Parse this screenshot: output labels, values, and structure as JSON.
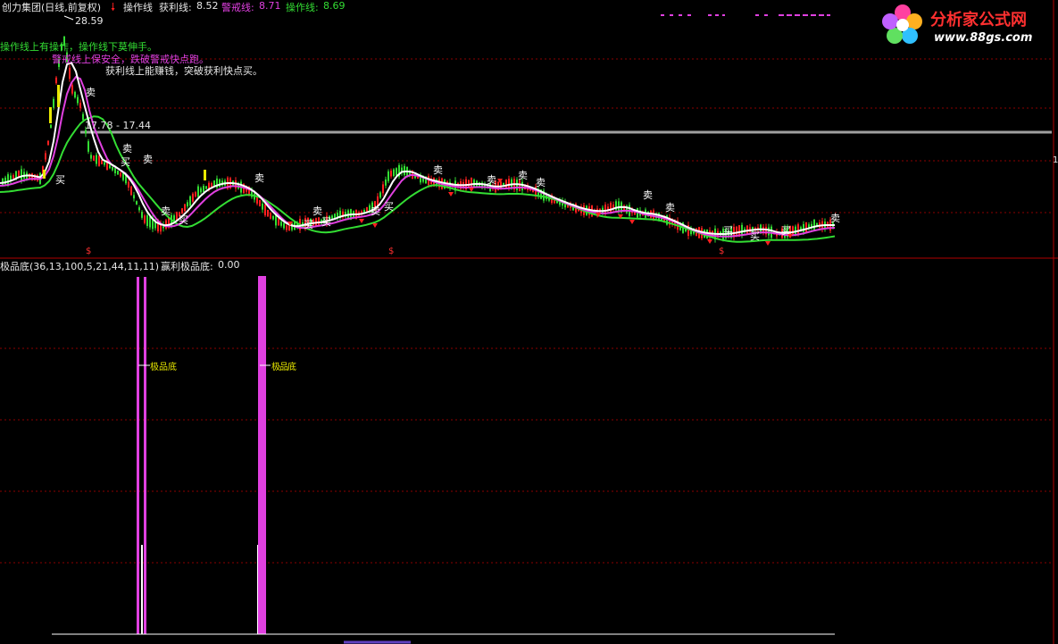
{
  "header": {
    "title": "创力集团(日线,前复权)",
    "items": [
      {
        "label": "操作线",
        "value": ""
      },
      {
        "label": "获利线:",
        "value": "8.52"
      },
      {
        "label": "警戒线:",
        "value": "8.71"
      },
      {
        "label": "操作线:",
        "value": "8.69"
      }
    ]
  },
  "notes": {
    "line1": "操作线上有操作，操作线下莫伸手。",
    "line2": "警戒线上保安全，跌破警戒快点跑。",
    "line3": "获利线上能赚钱，突破获利快点买。"
  },
  "annotations": {
    "high_price": "28.59",
    "range": "17.78 - 17.44",
    "sell": "卖",
    "buy": "买",
    "dollar": "$",
    "side_tick": "1"
  },
  "sub_panel": {
    "title": "极品底(36,13,100,5,21,44,11,11)",
    "indicator_label": "赢利极品底:",
    "indicator_value": "0.00",
    "signal_label": "极品底"
  },
  "logo": {
    "name": "分析家公式网",
    "url": "www.88gs.com"
  },
  "colors": {
    "background": "#000000",
    "grid": "#8b0000",
    "operation_line": "#33dd33",
    "warning_line": "#e040e0",
    "profit_line": "#ffffff",
    "up_candle": "#ff2020",
    "down_candle": "#33dd33",
    "signal_bar": "#e040e0"
  }
}
